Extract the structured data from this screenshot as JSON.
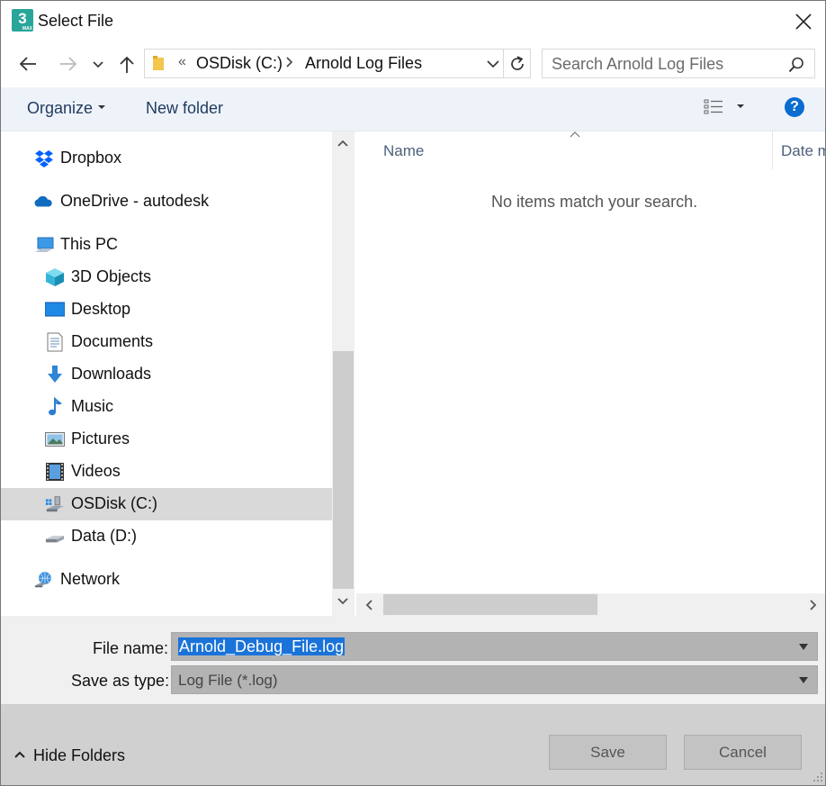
{
  "window": {
    "title": "Select File",
    "app_icon": {
      "glyph": "3",
      "sub": "MAX",
      "name": "3ds-max-icon",
      "color": "#2aa59a"
    }
  },
  "navigation": {
    "breadcrumb": {
      "overflow": "«",
      "items": [
        "OSDisk (C:)",
        "Arnold Log Files"
      ]
    },
    "search": {
      "placeholder": "Search Arnold Log Files",
      "value": ""
    }
  },
  "toolbar": {
    "organize_label": "Organize",
    "new_folder_label": "New folder",
    "help_label": "?"
  },
  "nav_pane": {
    "items": [
      {
        "label": "Dropbox",
        "icon": "dropbox-icon",
        "level": 0,
        "selected": false
      },
      {
        "label": "OneDrive - autodesk",
        "icon": "onedrive-icon",
        "level": 0,
        "selected": false
      },
      {
        "label": "This PC",
        "icon": "this-pc-icon",
        "level": 0,
        "selected": false
      },
      {
        "label": "3D Objects",
        "icon": "3d-objects-icon",
        "level": 1,
        "selected": false
      },
      {
        "label": "Desktop",
        "icon": "desktop-icon",
        "level": 1,
        "selected": false
      },
      {
        "label": "Documents",
        "icon": "documents-icon",
        "level": 1,
        "selected": false
      },
      {
        "label": "Downloads",
        "icon": "downloads-icon",
        "level": 1,
        "selected": false
      },
      {
        "label": "Music",
        "icon": "music-icon",
        "level": 1,
        "selected": false
      },
      {
        "label": "Pictures",
        "icon": "pictures-icon",
        "level": 1,
        "selected": false
      },
      {
        "label": "Videos",
        "icon": "videos-icon",
        "level": 1,
        "selected": false
      },
      {
        "label": "OSDisk (C:)",
        "icon": "os-disk-icon",
        "level": 1,
        "selected": true
      },
      {
        "label": "Data (D:)",
        "icon": "drive-icon",
        "level": 1,
        "selected": false
      },
      {
        "label": "Network",
        "icon": "network-icon",
        "level": 0,
        "selected": false
      }
    ]
  },
  "content": {
    "columns": [
      "Name",
      "Date m"
    ],
    "empty_message": "No items match your search."
  },
  "form": {
    "file_name_label": "File name:",
    "file_name_value": "Arnold_Debug_File.log",
    "save_as_type_label": "Save as type:",
    "save_as_type_value": "Log File (*.log)"
  },
  "footer": {
    "hide_folders_label": "Hide Folders",
    "save_label": "Save",
    "cancel_label": "Cancel"
  },
  "colors": {
    "toolbar_bg": "#eef3f9",
    "selection": "#1a73d8",
    "help_blue": "#0a6cd1",
    "footer_bg": "#d0d0d0"
  }
}
